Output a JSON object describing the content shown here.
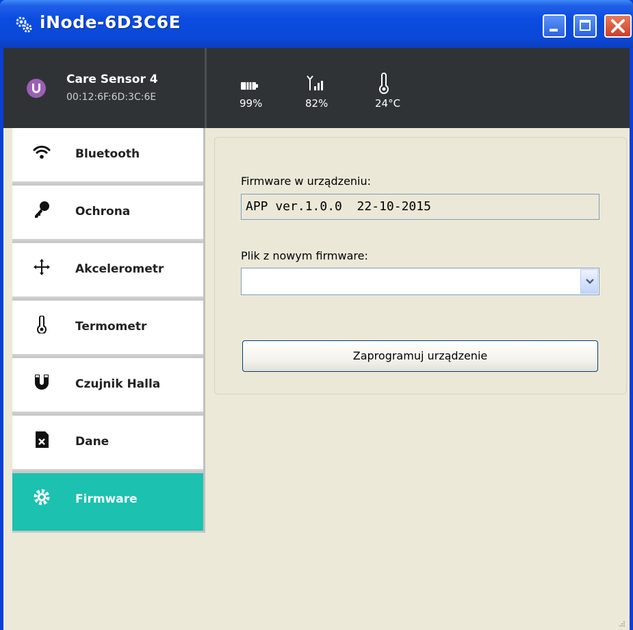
{
  "window": {
    "title": "iNode-6D3C6E",
    "icons": [
      "gears-icon",
      "minimize-icon",
      "maximize-icon",
      "close-icon"
    ]
  },
  "device": {
    "name": "Care Sensor 4",
    "mac": "00:12:6F:6D:3C:6E",
    "avatar_icon": "magnet-badge-icon"
  },
  "stats": [
    {
      "icon": "battery-icon",
      "value": "99%"
    },
    {
      "icon": "signal-icon",
      "value": "82%"
    },
    {
      "icon": "thermometer-icon",
      "value": "24°C"
    }
  ],
  "sidebar": {
    "items": [
      {
        "label": "Bluetooth",
        "icon": "wifi-icon"
      },
      {
        "label": "Ochrona",
        "icon": "key-icon"
      },
      {
        "label": "Akcelerometr",
        "icon": "move-arrows-icon"
      },
      {
        "label": "Termometr",
        "icon": "thermometer-icon"
      },
      {
        "label": "Czujnik Halla",
        "icon": "magnet-icon"
      },
      {
        "label": "Dane",
        "icon": "sd-card-icon"
      },
      {
        "label": "Firmware",
        "icon": "gear-icon",
        "active": true
      }
    ]
  },
  "firmware": {
    "current_label": "Firmware w urządzeniu:",
    "current_value": "APP ver.1.0.0  22-10-2015",
    "file_label": "Plik z nowym firmware:",
    "file_value": "",
    "program_button": "Zaprogramuj urządzenie"
  },
  "colors": {
    "header_bg": "#2f3336",
    "accent": "#1cc1b0",
    "titlebar": "#0a48d8",
    "window_bg": "#ece9d8"
  }
}
